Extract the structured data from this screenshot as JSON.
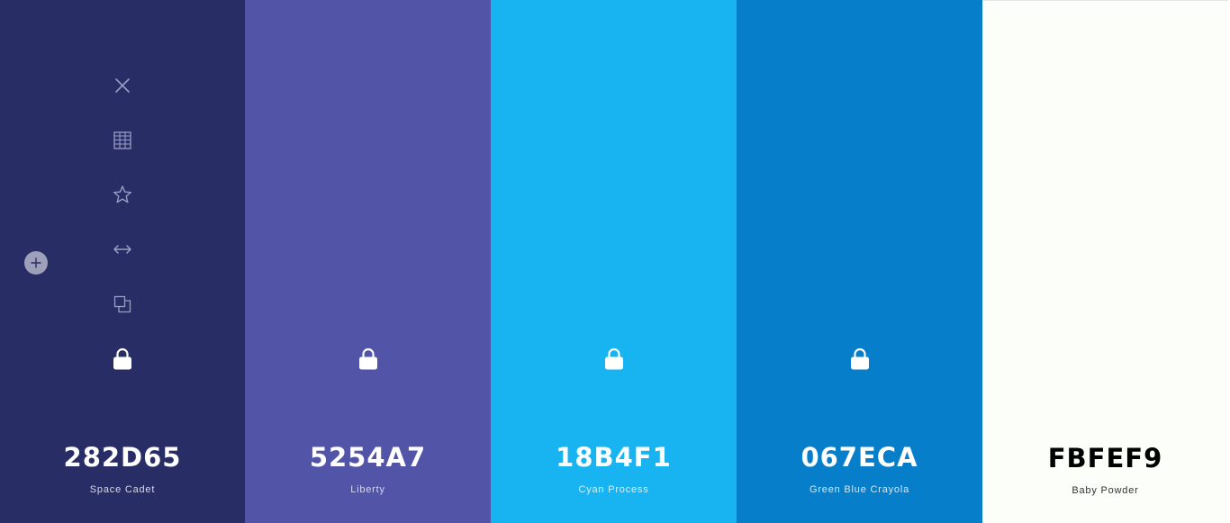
{
  "palette": {
    "colors": [
      {
        "hex": "282D65",
        "name": "Space Cadet",
        "bg": "#282D65",
        "text_color": "#FFFFFF",
        "name_color": "#D9DAE6"
      },
      {
        "hex": "5254A7",
        "name": "Liberty",
        "bg": "#5254A7",
        "text_color": "#FFFFFF",
        "name_color": "#D6D7EE"
      },
      {
        "hex": "18B4F1",
        "name": "Cyan Process",
        "bg": "#18B4F1",
        "text_color": "#FFFFFF",
        "name_color": "#D6F1FC"
      },
      {
        "hex": "067ECA",
        "name": "Green Blue Crayola",
        "bg": "#067ECA",
        "text_color": "#FFFFFF",
        "name_color": "#D2E8F6"
      },
      {
        "hex": "FBFEF9",
        "name": "Baby Powder",
        "bg": "#FBFEF9",
        "text_color": "#000000",
        "name_color": "#333333"
      }
    ]
  },
  "toolbar": {
    "icons": [
      "close-icon",
      "grid-icon",
      "star-icon",
      "drag-horizontal-icon",
      "copy-icon"
    ],
    "icon_color": "#9A9DC2"
  },
  "lock": {
    "icon": "lock-icon"
  },
  "add": {
    "icon": "plus-icon"
  }
}
